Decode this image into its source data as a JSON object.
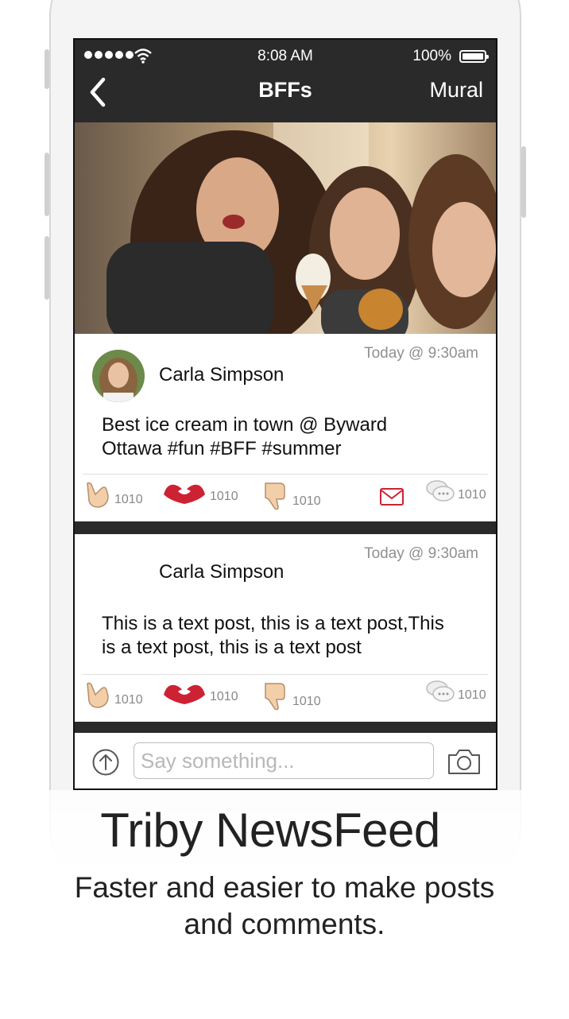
{
  "status_bar": {
    "time": "8:08 AM",
    "battery": "100%"
  },
  "nav": {
    "title": "BFFs",
    "right_label": "Mural"
  },
  "posts": [
    {
      "timestamp": "Today @ 9:30am",
      "author": "Carla Simpson",
      "text_line1": "Best ice cream in town @ Byward",
      "text_line2": "Ottawa #fun #BFF #summer",
      "counts": {
        "hang_loose": "1010",
        "heart_hands": "1010",
        "thumbs_down": "1010",
        "comments": "1010"
      }
    },
    {
      "timestamp": "Today @ 9:30am",
      "author": "Carla Simpson",
      "text_line1": "This is a text post, this is a text post,This",
      "text_line2": "is a text post, this is a text post",
      "counts": {
        "hang_loose": "1010",
        "heart_hands": "1010",
        "thumbs_down": "1010",
        "comments": "1010"
      }
    }
  ],
  "compose": {
    "placeholder": "Say something..."
  },
  "promo": {
    "headline": "Triby NewsFeed",
    "subline_1": "Faster and easier to make posts",
    "subline_2": "and comments."
  },
  "icons": {
    "upload": "upload-arrow-icon",
    "camera": "camera-icon",
    "mail": "mail-icon",
    "comment": "comment-bubbles-icon",
    "back": "chevron-left-icon",
    "wifi": "wifi-icon",
    "battery": "battery-icon"
  },
  "colors": {
    "nav_background": "#2a2a2a",
    "accent_red": "#cc2233",
    "skin_tone": "#f2cfa8"
  }
}
